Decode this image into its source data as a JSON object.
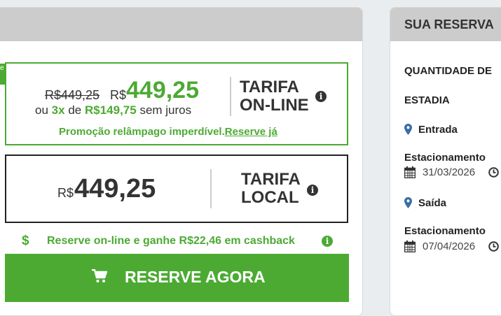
{
  "summary": {
    "title": "SUA RESERVA",
    "quantity_label": "QUANTIDADE DE",
    "stay_label": "ESTADIA",
    "entry_label": "Entrada",
    "entry_parking_label": "Estacionamento",
    "entry_date": "31/03/2026",
    "exit_label": "Saída",
    "exit_parking_label": "Estacionamento",
    "exit_date": "07/04/2026"
  },
  "online": {
    "tab_text": "e",
    "old_price": "R$449,25",
    "currency": "R$",
    "price": "449,25",
    "installment_prefix": "ou",
    "installment_count": "3x",
    "installment_mid": "de",
    "installment_value": "R$149,75",
    "installment_suffix": "sem juros",
    "tarifa_line1": "TARIFA",
    "tarifa_line2": "ON-LINE",
    "promo_text": "Promoção relâmpago imperdível.",
    "promo_link": "Reserve já",
    "green": "#4caa33"
  },
  "local": {
    "currency": "R$",
    "price": "449,25",
    "tarifa_line1": "TARIFA",
    "tarifa_line2": "LOCAL"
  },
  "cashback": {
    "symbol": "$",
    "text": "Reserve on-line e ganhe R$22,46 em cashback"
  },
  "cta": {
    "label": "RESERVE AGORA"
  },
  "icons": {
    "info": "i"
  }
}
